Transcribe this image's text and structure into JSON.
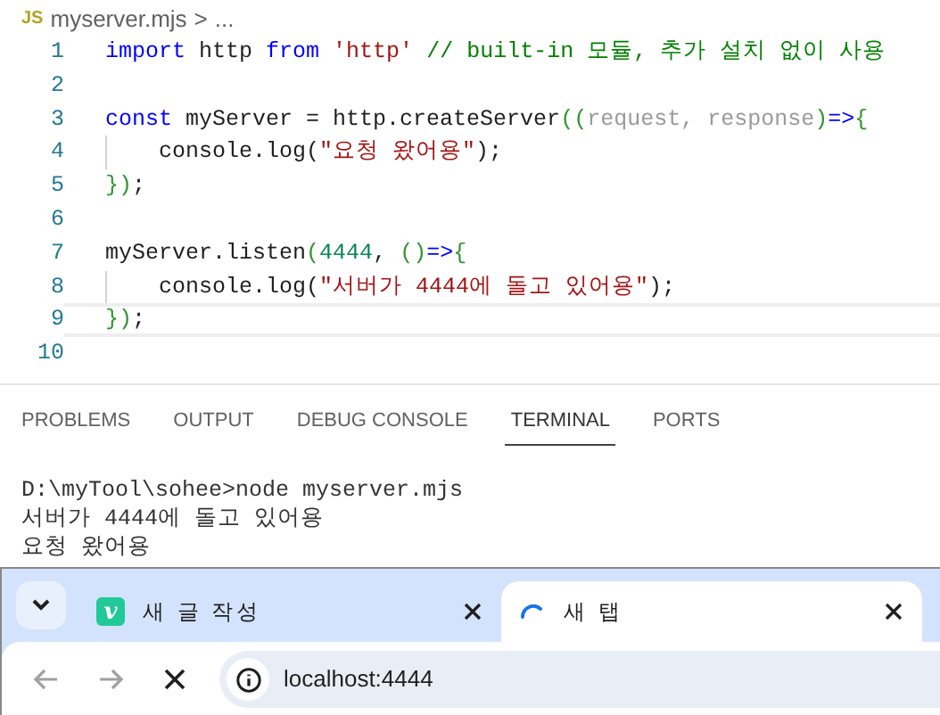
{
  "editor": {
    "breadcrumb": {
      "file_badge": "JS",
      "file": "myserver.mjs",
      "separator": ">",
      "more": "..."
    },
    "lines": [
      {
        "number": "1",
        "indent_guide": false,
        "current": false,
        "tokens": [
          {
            "kind": "keyword",
            "text": "import"
          },
          {
            "kind": "plain",
            "text": " http "
          },
          {
            "kind": "keyword",
            "text": "from"
          },
          {
            "kind": "string",
            "text": " 'http' "
          },
          {
            "kind": "comment",
            "text": "// built-in 모듈, 추가 설치 없이 사용"
          }
        ]
      },
      {
        "number": "2",
        "indent_guide": false,
        "current": false
      },
      {
        "number": "3",
        "indent_guide": false,
        "current": false,
        "tokens": [
          {
            "kind": "keyword",
            "text": "const"
          },
          {
            "kind": "plain",
            "text": " myServer = http.createServer"
          },
          {
            "kind": "bracket",
            "text": "(("
          },
          {
            "kind": "param",
            "text": "request, response"
          },
          {
            "kind": "bracket",
            "text": ")"
          },
          {
            "kind": "keyword",
            "text": "=>"
          },
          {
            "kind": "bracket",
            "text": "{"
          }
        ]
      },
      {
        "number": "4",
        "indent_guide": true,
        "current": false,
        "tokens": [
          {
            "kind": "plain",
            "text": "    console.log("
          },
          {
            "kind": "string",
            "text": "\"요청 왔어용\""
          },
          {
            "kind": "plain",
            "text": ");"
          }
        ]
      },
      {
        "number": "5",
        "indent_guide": false,
        "current": false,
        "tokens": [
          {
            "kind": "bracket",
            "text": "})"
          },
          {
            "kind": "plain",
            "text": ";"
          }
        ]
      },
      {
        "number": "6",
        "indent_guide": false,
        "current": false
      },
      {
        "number": "7",
        "indent_guide": false,
        "current": false,
        "tokens": [
          {
            "kind": "plain",
            "text": "myServer.listen"
          },
          {
            "kind": "bracket",
            "text": "("
          },
          {
            "kind": "number",
            "text": "4444"
          },
          {
            "kind": "plain",
            "text": ", "
          },
          {
            "kind": "bracket",
            "text": "()"
          },
          {
            "kind": "keyword",
            "text": "=>"
          },
          {
            "kind": "bracket",
            "text": "{"
          }
        ]
      },
      {
        "number": "8",
        "indent_guide": true,
        "current": false,
        "tokens": [
          {
            "kind": "plain",
            "text": "    console.log("
          },
          {
            "kind": "string",
            "text": "\"서버가 4444에 돌고 있어용\""
          },
          {
            "kind": "plain",
            "text": ");"
          }
        ]
      },
      {
        "number": "9",
        "indent_guide": false,
        "current": true,
        "tokens": [
          {
            "kind": "bracket",
            "text": "})"
          },
          {
            "kind": "plain",
            "text": ";"
          }
        ]
      },
      {
        "number": "10",
        "indent_guide": false,
        "current": false
      }
    ]
  },
  "panel": {
    "tabs": [
      {
        "label": "PROBLEMS",
        "selected": false
      },
      {
        "label": "OUTPUT",
        "selected": false
      },
      {
        "label": "DEBUG CONSOLE",
        "selected": false
      },
      {
        "label": "TERMINAL",
        "selected": true
      },
      {
        "label": "PORTS",
        "selected": false
      }
    ],
    "terminal_lines": [
      "D:\\myTool\\sohee>node myserver.mjs",
      "서버가 4444에 돌고 있어용",
      "요청 왔어용"
    ]
  },
  "browser": {
    "tabs": [
      {
        "title": "새 글 작성",
        "icon_letter": "v",
        "selected": false
      },
      {
        "title": "새 탭",
        "selected": true
      }
    ],
    "back_disabled": true,
    "forward_disabled": true,
    "url": "localhost:4444"
  }
}
